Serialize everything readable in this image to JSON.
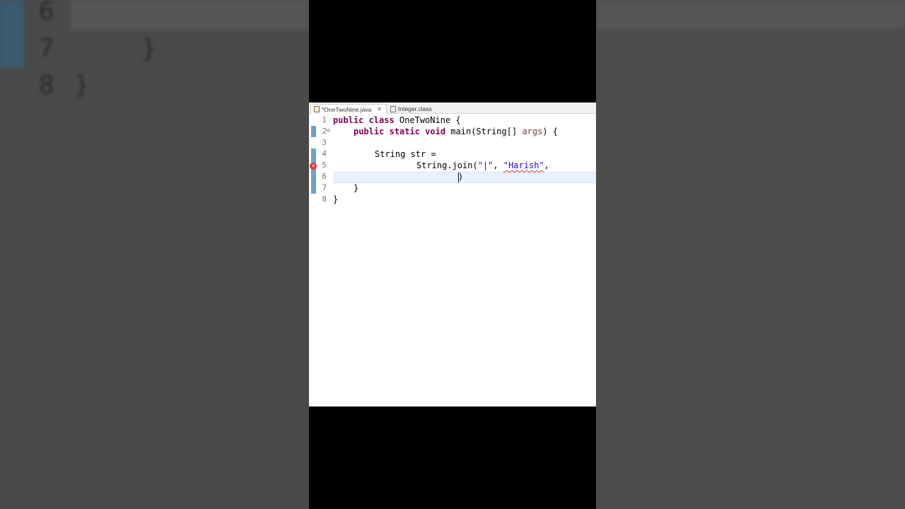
{
  "background": {
    "line_numbers": [
      "6",
      "7",
      "8"
    ],
    "brace_close_inner": "}",
    "brace_close_outer": "}"
  },
  "editor": {
    "tabs": [
      {
        "label": "*OneTwoNine.java",
        "icon": "java-file-icon",
        "active": true
      },
      {
        "label": "Integer.class",
        "icon": "class-file-icon",
        "active": false
      }
    ],
    "line_numbers": [
      "1",
      "2",
      "3",
      "4",
      "5",
      "6",
      "7",
      "8"
    ],
    "code": {
      "l1_kw": "public class ",
      "l1_rest": "OneTwoNine {",
      "l2_kw": "public static void ",
      "l2_rest": "main(String[] ",
      "l2_param": "args",
      "l2_end": ") {",
      "l4": "String str =",
      "l5_pre": "String.join(",
      "l5_str1": "\"|\"",
      "l5_mid": ", ",
      "l5_str2": "\"Harish\"",
      "l5_end": ",",
      "l6": ")",
      "l7": "}",
      "l8": "}"
    },
    "accent_color": "#6aa3cf",
    "keyword_color": "#7f0055",
    "string_color": "#2a00ff"
  }
}
